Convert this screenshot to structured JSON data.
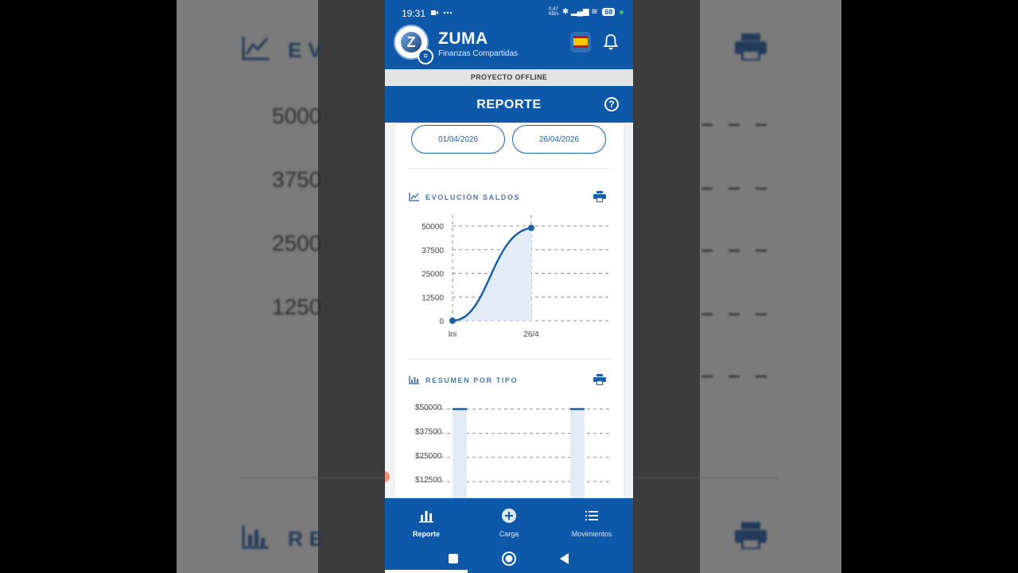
{
  "status_bar": {
    "time": "19:31",
    "net_speed": "0,47 KB/s",
    "battery": "68",
    "icons": [
      "video-icon",
      "more-icon",
      "bluetooth-icon",
      "signal-icon",
      "wifi-icon",
      "battery-icon"
    ]
  },
  "app": {
    "name": "ZUMA",
    "subtitle": "Finanzas Compartidas",
    "logo_letter": "Z"
  },
  "banner": "PROYECTO OFFLINE",
  "report": {
    "title": "REPORTE",
    "help_glyph": "?",
    "date_from": "01/04/2026",
    "date_to": "26/04/2026"
  },
  "balance_section": {
    "title": "EVOLUCIÓN SALDOS"
  },
  "summary_section": {
    "title": "RESUMEN POR TIPO"
  },
  "nav": {
    "items": [
      {
        "label": "Reporte",
        "icon": "bar-chart-icon",
        "active": true
      },
      {
        "label": "Carga",
        "icon": "add-circle-icon",
        "active": false
      },
      {
        "label": "Movimientos",
        "icon": "list-icon",
        "active": false
      }
    ]
  },
  "background_echo": {
    "title_fragment": "EV",
    "title_fragment_2": "RE",
    "ticks": [
      "5000",
      "3750",
      "2500",
      "1250"
    ]
  },
  "colors": {
    "primary": "#0d58a8",
    "line": "#1d5fa8",
    "area_fill": "#e3ecf6",
    "section_title": "#4c78a4"
  },
  "chart_data": [
    {
      "type": "line",
      "x": [
        "Ini",
        "26/4"
      ],
      "y": [
        0,
        49000
      ],
      "yticks": [
        0,
        12500,
        25000,
        37500,
        50000
      ],
      "ylim": [
        0,
        50000
      ],
      "grid": true,
      "title": "",
      "xlabel": "",
      "ylabel": ""
    },
    {
      "type": "bar",
      "categories": [
        "",
        ""
      ],
      "values": [
        50000,
        50000
      ],
      "yticks": [
        "$12500",
        "$25000",
        "$37500",
        "$50000"
      ],
      "ylim": [
        0,
        50000
      ],
      "grid": true,
      "title": "",
      "xlabel": "",
      "ylabel": ""
    }
  ]
}
